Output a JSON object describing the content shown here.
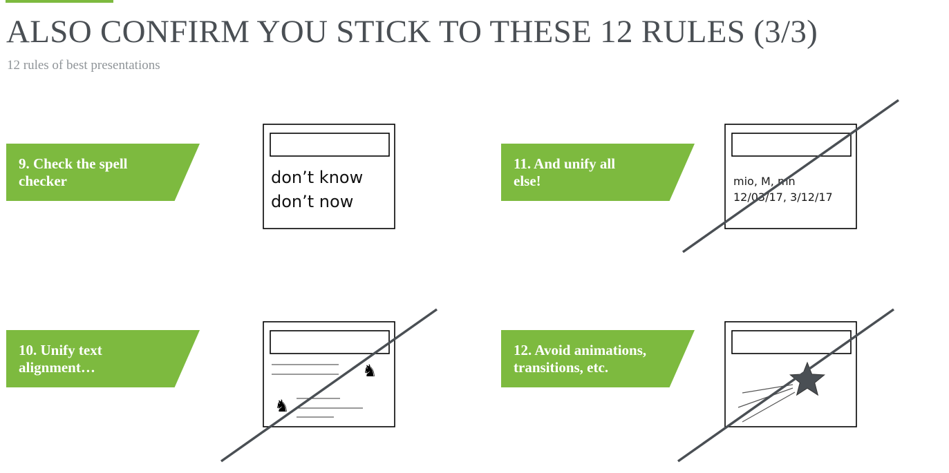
{
  "slide": {
    "title": "ALSO CONFIRM YOU STICK TO THESE 12 RULES (3/3)",
    "subtitle": "12 rules of best presentations",
    "accent_color": "#7dba3f",
    "line_color": "#4a4f54"
  },
  "rules": [
    {
      "line1": "9. Check the spell",
      "line2": "checker",
      "illustration": {
        "icon": "slide-with-spelling-variants",
        "text_lines": [
          "don’t know",
          "don’t now"
        ]
      }
    },
    {
      "line1": "10. Unify text",
      "line2": "alignment…",
      "illustration": {
        "icon": "slide-with-misaligned-chess-knights-crossed-out"
      }
    },
    {
      "line1": "11. And unify all",
      "line2": "else!",
      "illustration": {
        "icon": "slide-with-inconsistent-formats-crossed-out",
        "text_lines": [
          "mio, M, mn",
          "12/03/17, 3/12/17"
        ]
      }
    },
    {
      "line1": "12. Avoid animations,",
      "line2": "transitions, etc.",
      "illustration": {
        "icon": "slide-with-shooting-star-crossed-out"
      }
    }
  ]
}
